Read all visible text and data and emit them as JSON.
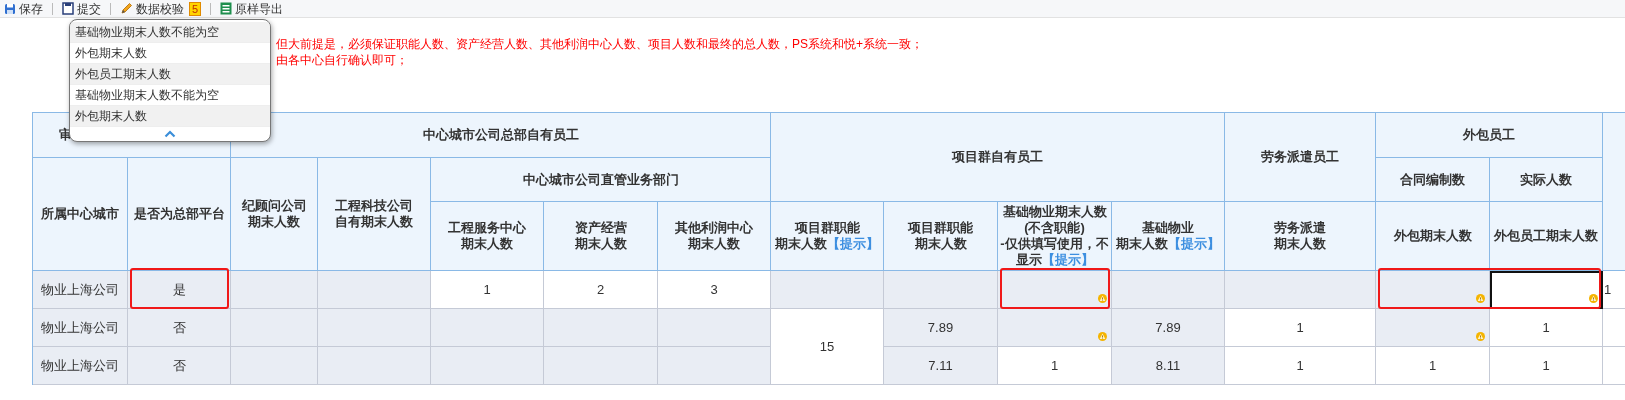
{
  "toolbar": [
    {
      "label": "保存"
    },
    {
      "label": "提交"
    },
    {
      "label": "数据校验",
      "badge": "5"
    },
    {
      "label": "原样导出"
    }
  ],
  "notice_lines": [
    "但大前提是，必须保证职能人数、资产经营人数、其他利润中心人数、项目人数和最终的总人数，PS系统和悦+系统一致；",
    "由各中心自行确认即可；"
  ],
  "validation_popup": {
    "items": [
      "基础物业期末人数不能为空",
      "外包期末人数",
      "外包员工期末人数",
      "基础物业期末人数不能为空",
      "外包期末人数"
    ]
  },
  "table": {
    "header_rows": [
      {
        "cells": [
          {
            "lines": [
              "审"
            ],
            "colspan": 2
          },
          {
            "lines": [
              "中心城市公司总部自有员工"
            ],
            "colspan": 5
          },
          {
            "lines": [
              "项目群自有员工"
            ],
            "rowspan": 2,
            "colspan": 4
          },
          {
            "lines": [
              "劳务派遣员工"
            ],
            "rowspan": 2
          },
          {
            "lines": [
              "外包员工"
            ],
            "colspan": 2
          },
          {
            "rowspan": 3
          }
        ]
      },
      {
        "cells": [
          {
            "lines": [
              "所属中心城市"
            ],
            "rowspan": 2
          },
          {
            "lines": [
              "是否为总部平台"
            ],
            "rowspan": 2
          },
          {
            "lines": [
              "纪顾问公司",
              "期末人数"
            ],
            "rowspan": 2
          },
          {
            "lines": [
              "工程科技公司",
              "自有期末人数"
            ],
            "rowspan": 2
          },
          {
            "lines": [
              "中心城市公司直管业务部门"
            ],
            "colspan": 3
          },
          {
            "lines": [
              "合同编制数"
            ]
          },
          {
            "lines": [
              "实际人数"
            ]
          }
        ]
      },
      {
        "cells": [
          {
            "lines": [
              "工程服务中心",
              "期末人数"
            ]
          },
          {
            "lines": [
              "资产经营",
              "期末人数"
            ]
          },
          {
            "lines": [
              "其他利润中心",
              "期末人数"
            ]
          },
          {
            "lines": [
              "项目群职能",
              "期末人数"
            ],
            "hint": "【提示】"
          },
          {
            "lines": [
              "项目群职能",
              "期末人数"
            ]
          },
          {
            "lines": [
              "基础物业期末人数",
              "(不含职能)",
              "-仅供填写使用，不",
              "显示"
            ],
            "hint": "【提示】"
          },
          {
            "lines": [
              "基础物业",
              "期末人数"
            ],
            "hint": "【提示】"
          },
          {
            "lines": [
              "劳务派遣",
              "期末人数"
            ]
          },
          {
            "lines": [
              "外包期末人数"
            ]
          },
          {
            "lines": [
              "外包员工期末人数"
            ]
          }
        ]
      }
    ],
    "rows": [
      {
        "cells": [
          {
            "text": "物业上海公司",
            "editable": false,
            "warning": false,
            "selected": false,
            "flagged": false
          },
          {
            "text": "是",
            "editable": false,
            "warning": false,
            "selected": false,
            "flagged": true
          },
          {
            "editable": false,
            "warning": false,
            "selected": false,
            "flagged": false
          },
          {
            "editable": false,
            "warning": false,
            "selected": false,
            "flagged": false
          },
          {
            "text": "1",
            "editable": true,
            "warning": false,
            "selected": false,
            "flagged": false
          },
          {
            "text": "2",
            "editable": true,
            "warning": false,
            "selected": false,
            "flagged": false
          },
          {
            "text": "3",
            "editable": true,
            "warning": false,
            "selected": false,
            "flagged": false
          },
          {
            "editable": false,
            "warning": false,
            "selected": false,
            "flagged": false
          },
          {
            "editable": false,
            "warning": false,
            "selected": false,
            "flagged": false
          },
          {
            "editable": false,
            "warning": true,
            "selected": false,
            "flagged": true
          },
          {
            "editable": false,
            "warning": false,
            "selected": false,
            "flagged": false
          },
          {
            "editable": false,
            "warning": false,
            "selected": false,
            "flagged": false
          },
          {
            "editable": false,
            "warning": true,
            "selected": false,
            "flagged": true
          },
          {
            "editable": true,
            "warning": true,
            "selected": true,
            "flagged": true
          },
          {
            "text": "1",
            "editable": true,
            "warning": false,
            "selected": false,
            "flagged": false
          }
        ]
      },
      {
        "cells": [
          {
            "text": "物业上海公司",
            "editable": false,
            "warning": false,
            "selected": false,
            "flagged": false
          },
          {
            "text": "否",
            "editable": false,
            "warning": false,
            "selected": false,
            "flagged": false
          },
          {
            "editable": false,
            "warning": false,
            "selected": false,
            "flagged": false
          },
          {
            "editable": false,
            "warning": false,
            "selected": false,
            "flagged": false
          },
          {
            "editable": false,
            "warning": false,
            "selected": false,
            "flagged": false
          },
          {
            "editable": false,
            "warning": false,
            "selected": false,
            "flagged": false
          },
          {
            "editable": false,
            "warning": false,
            "selected": false,
            "flagged": false
          },
          {
            "text": "15",
            "rowspan": 2,
            "editable": true,
            "warning": false,
            "selected": false,
            "flagged": false
          },
          {
            "text": "7.89",
            "editable": false,
            "warning": false,
            "selected": false,
            "flagged": false
          },
          {
            "editable": false,
            "warning": true,
            "selected": false,
            "flagged": false
          },
          {
            "text": "7.89",
            "editable": false,
            "warning": false,
            "selected": false,
            "flagged": false
          },
          {
            "text": "1",
            "editable": true,
            "warning": false,
            "selected": false,
            "flagged": false
          },
          {
            "editable": false,
            "warning": true,
            "selected": false,
            "flagged": false
          },
          {
            "text": "1",
            "editable": true,
            "warning": false,
            "selected": false,
            "flagged": false
          },
          {
            "editable": true,
            "warning": false,
            "selected": false,
            "flagged": false
          }
        ]
      },
      {
        "cells": [
          {
            "text": "物业上海公司",
            "editable": false,
            "warning": false,
            "selected": false,
            "flagged": false
          },
          {
            "text": "否",
            "editable": false,
            "warning": false,
            "selected": false,
            "flagged": false
          },
          {
            "editable": false,
            "warning": false,
            "selected": false,
            "flagged": false
          },
          {
            "editable": false,
            "warning": false,
            "selected": false,
            "flagged": false
          },
          {
            "editable": false,
            "warning": false,
            "selected": false,
            "flagged": false
          },
          {
            "editable": false,
            "warning": false,
            "selected": false,
            "flagged": false
          },
          {
            "editable": false,
            "warning": false,
            "selected": false,
            "flagged": false
          },
          {
            "text": "7.11",
            "editable": false,
            "warning": false,
            "selected": false,
            "flagged": false
          },
          {
            "text": "1",
            "editable": true,
            "warning": false,
            "selected": false,
            "flagged": false
          },
          {
            "text": "8.11",
            "editable": false,
            "warning": false,
            "selected": false,
            "flagged": false
          },
          {
            "text": "1",
            "editable": true,
            "warning": false,
            "selected": false,
            "flagged": false
          },
          {
            "text": "1",
            "editable": true,
            "warning": false,
            "selected": false,
            "flagged": false
          },
          {
            "text": "1",
            "editable": true,
            "warning": false,
            "selected": false,
            "flagged": false
          },
          {
            "editable": true,
            "warning": false,
            "selected": false,
            "flagged": false
          }
        ]
      }
    ]
  }
}
